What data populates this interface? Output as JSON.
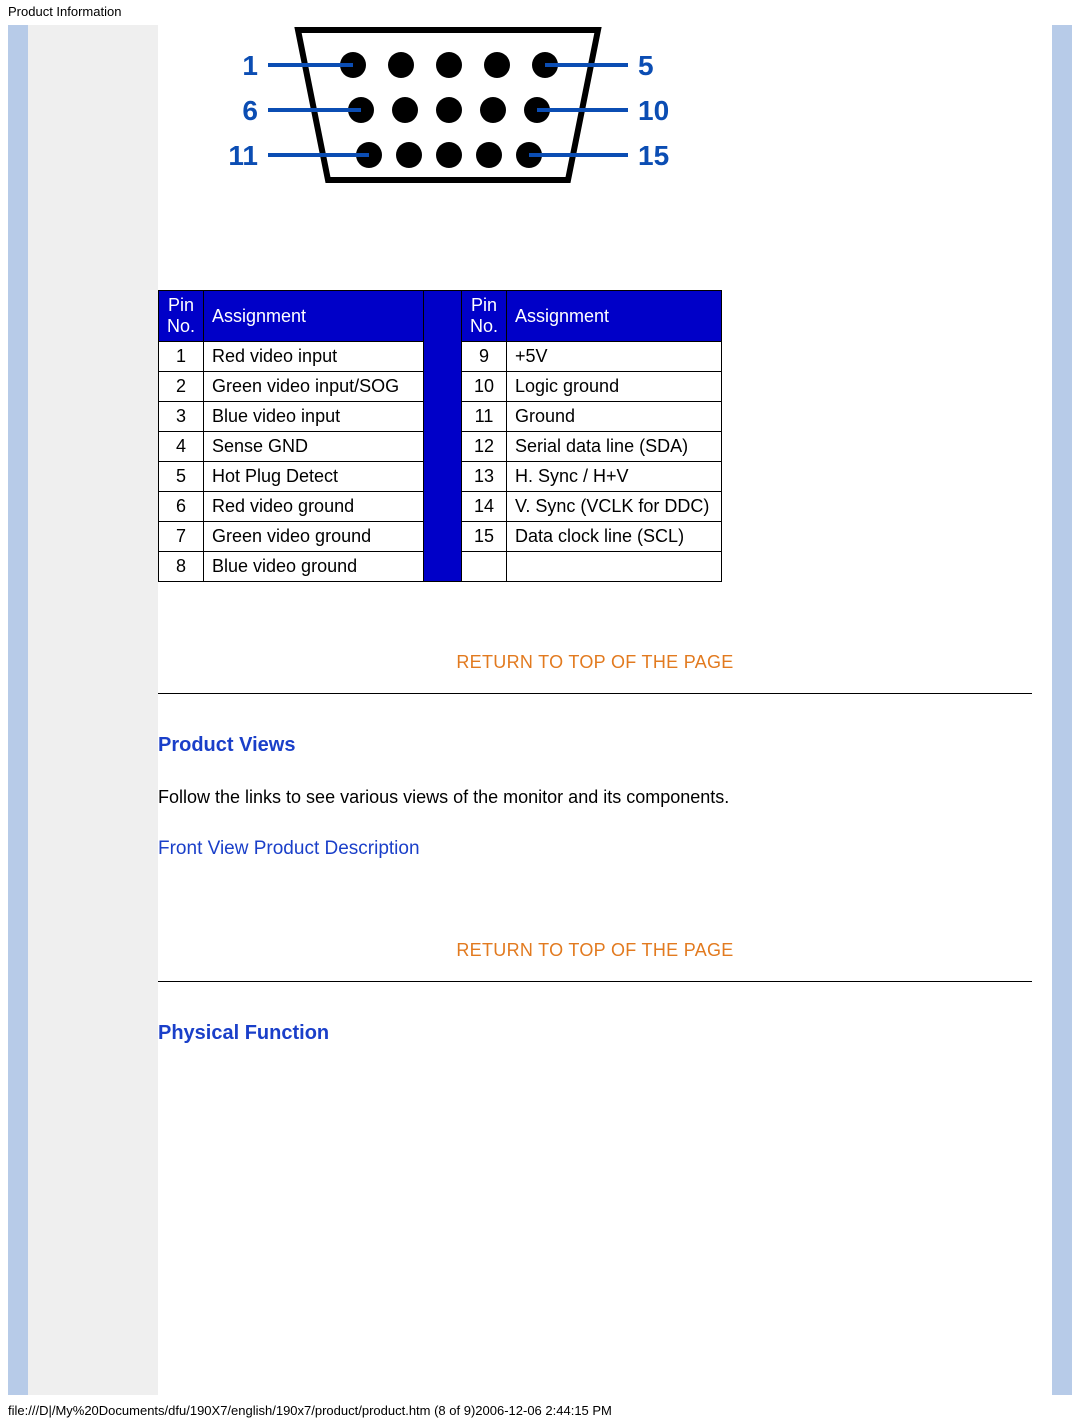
{
  "header_title": "Product Information",
  "diagram": {
    "left_labels": [
      "1",
      "6",
      "11"
    ],
    "right_labels": [
      "5",
      "10",
      "15"
    ]
  },
  "pin_table": {
    "headers": {
      "pin_no": "Pin No.",
      "assignment": "Assignment"
    },
    "left_rows": [
      {
        "no": "1",
        "assign": "Red video input"
      },
      {
        "no": "2",
        "assign": "Green video input/SOG"
      },
      {
        "no": "3",
        "assign": "Blue video input"
      },
      {
        "no": "4",
        "assign": "Sense GND"
      },
      {
        "no": "5",
        "assign": "Hot Plug Detect"
      },
      {
        "no": "6",
        "assign": "Red video ground"
      },
      {
        "no": "7",
        "assign": "Green video ground"
      },
      {
        "no": "8",
        "assign": "Blue video ground"
      }
    ],
    "right_rows": [
      {
        "no": "9",
        "assign": "+5V"
      },
      {
        "no": "10",
        "assign": "Logic ground"
      },
      {
        "no": "11",
        "assign": "Ground"
      },
      {
        "no": "12",
        "assign": "Serial data line (SDA)"
      },
      {
        "no": "13",
        "assign": "H. Sync / H+V"
      },
      {
        "no": "14",
        "assign": "V. Sync (VCLK for DDC)"
      },
      {
        "no": "15",
        "assign": "Data clock line (SCL)"
      },
      {
        "no": "",
        "assign": ""
      }
    ]
  },
  "return_top_label": "RETURN TO TOP OF THE PAGE",
  "sections": {
    "product_views": {
      "title": "Product Views",
      "body": "Follow the links to see various views of the monitor and its components.",
      "link": "Front View Product Description"
    },
    "physical_function": {
      "title": "Physical Function"
    }
  },
  "footer_text": "file:///D|/My%20Documents/dfu/190X7/english/190x7/product/product.htm (8 of 9)2006-12-06 2:44:15 PM"
}
